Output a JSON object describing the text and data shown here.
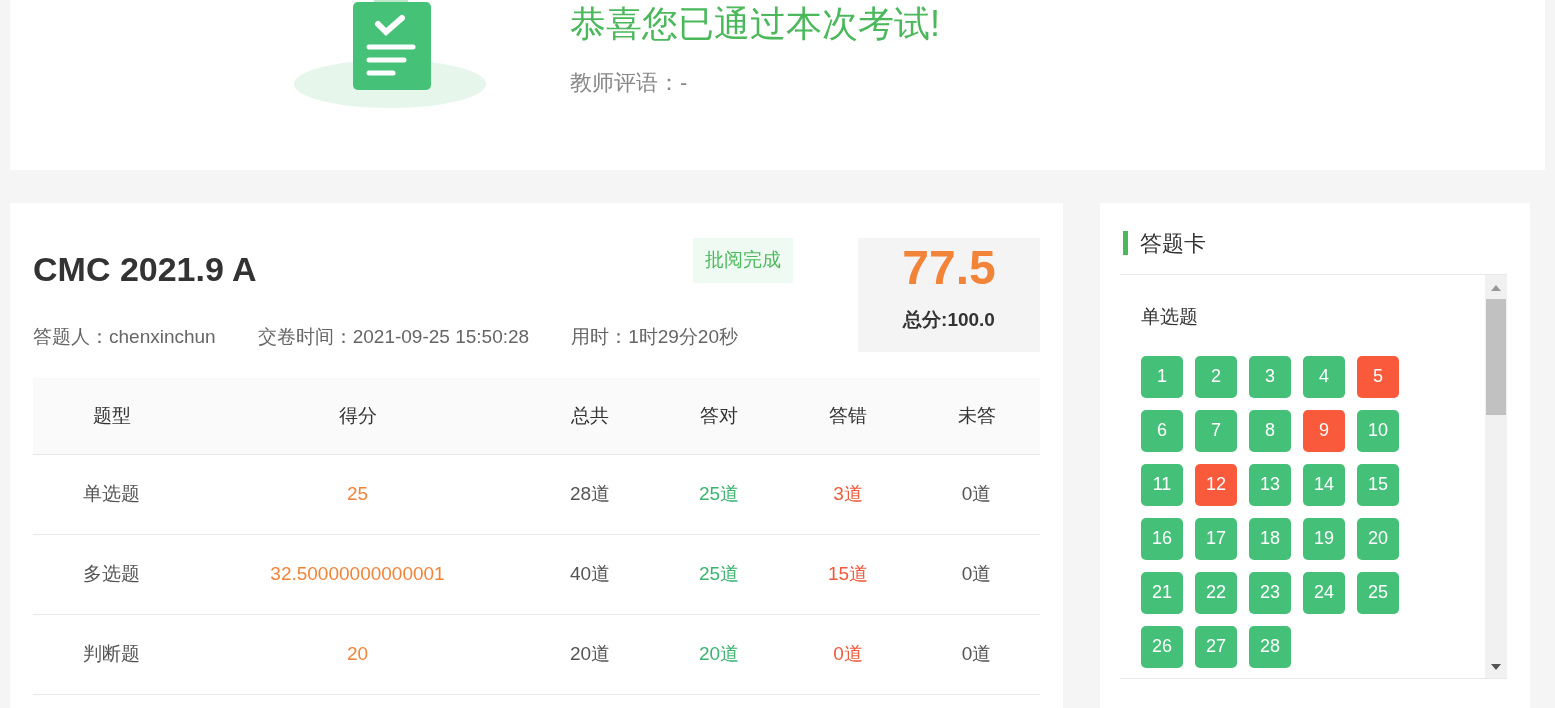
{
  "result": {
    "title": "恭喜您已通过本次考试!",
    "comment": "教师评语：-"
  },
  "exam": {
    "title": "CMC 2021.9 A",
    "status": "批阅完成",
    "score": "77.5",
    "total": "总分:100.0",
    "meta": [
      "答题人：chenxinchun",
      "交卷时间：2021-09-25 15:50:28",
      "用时：1时29分20秒"
    ]
  },
  "table": {
    "columns": [
      "题型",
      "得分",
      "总共",
      "答对",
      "答错",
      "未答"
    ],
    "rows": [
      [
        "单选题",
        "25",
        "28道",
        "25道",
        "3道",
        "0道"
      ],
      [
        "多选题",
        "32.50000000000001",
        "40道",
        "25道",
        "15道",
        "0道"
      ],
      [
        "判断题",
        "20",
        "20道",
        "20道",
        "0道",
        "0道"
      ]
    ]
  },
  "answer_card": {
    "title": "答题卡",
    "section": "单选题",
    "items": [
      {
        "label": "1",
        "correct": true
      },
      {
        "label": "2",
        "correct": true
      },
      {
        "label": "3",
        "correct": true
      },
      {
        "label": "4",
        "correct": true
      },
      {
        "label": "5",
        "correct": false
      },
      {
        "label": "6",
        "correct": true
      },
      {
        "label": "7",
        "correct": true
      },
      {
        "label": "8",
        "correct": true
      },
      {
        "label": "9",
        "correct": false
      },
      {
        "label": "10",
        "correct": true
      },
      {
        "label": "11",
        "correct": true
      },
      {
        "label": "12",
        "correct": false
      },
      {
        "label": "13",
        "correct": true
      },
      {
        "label": "14",
        "correct": true
      },
      {
        "label": "15",
        "correct": true
      },
      {
        "label": "16",
        "correct": true
      },
      {
        "label": "17",
        "correct": true
      },
      {
        "label": "18",
        "correct": true
      },
      {
        "label": "19",
        "correct": true
      },
      {
        "label": "20",
        "correct": true
      },
      {
        "label": "21",
        "correct": true
      },
      {
        "label": "22",
        "correct": true
      },
      {
        "label": "23",
        "correct": true
      },
      {
        "label": "24",
        "correct": true
      },
      {
        "label": "25",
        "correct": true
      },
      {
        "label": "26",
        "correct": true
      },
      {
        "label": "27",
        "correct": true
      },
      {
        "label": "28",
        "correct": true
      }
    ]
  }
}
